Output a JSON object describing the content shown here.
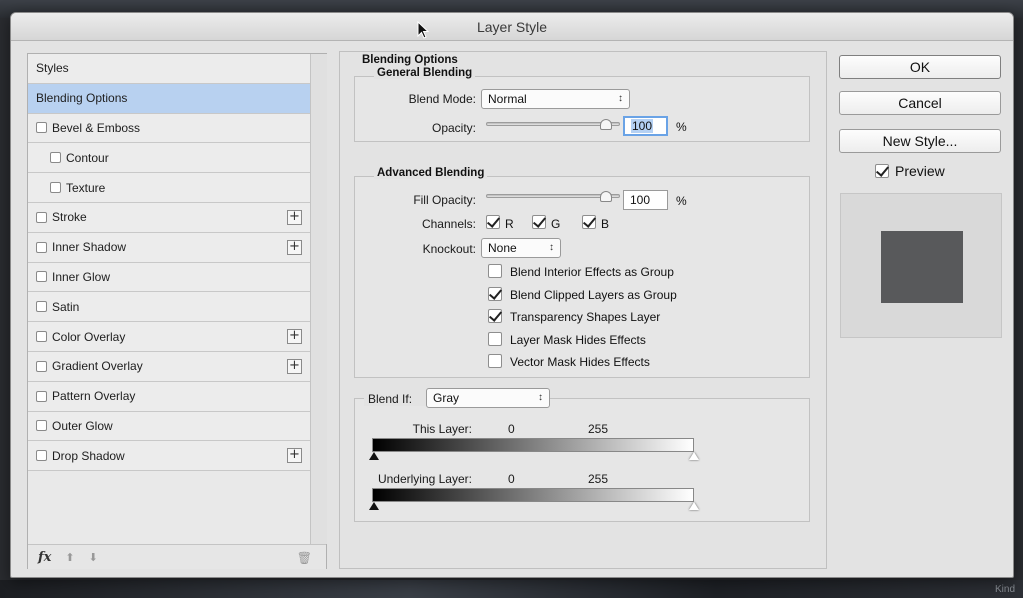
{
  "window": {
    "title": "Layer Style",
    "kind_label": "Kind"
  },
  "styles": {
    "header": "Styles",
    "items": [
      {
        "label": "Blending Options",
        "checkbox": false,
        "indent": false,
        "plus": false,
        "selected": true
      },
      {
        "label": "Bevel & Emboss",
        "checkbox": true,
        "indent": false,
        "plus": false
      },
      {
        "label": "Contour",
        "checkbox": true,
        "indent": true,
        "plus": false
      },
      {
        "label": "Texture",
        "checkbox": true,
        "indent": true,
        "plus": false
      },
      {
        "label": "Stroke",
        "checkbox": true,
        "indent": false,
        "plus": true
      },
      {
        "label": "Inner Shadow",
        "checkbox": true,
        "indent": false,
        "plus": true
      },
      {
        "label": "Inner Glow",
        "checkbox": true,
        "indent": false,
        "plus": false
      },
      {
        "label": "Satin",
        "checkbox": true,
        "indent": false,
        "plus": false
      },
      {
        "label": "Color Overlay",
        "checkbox": true,
        "indent": false,
        "plus": true
      },
      {
        "label": "Gradient Overlay",
        "checkbox": true,
        "indent": false,
        "plus": true
      },
      {
        "label": "Pattern Overlay",
        "checkbox": true,
        "indent": false,
        "plus": false
      },
      {
        "label": "Outer Glow",
        "checkbox": true,
        "indent": false,
        "plus": false
      },
      {
        "label": "Drop Shadow",
        "checkbox": true,
        "indent": false,
        "plus": true
      }
    ],
    "footer": {
      "fx_label": "fx",
      "plus_symbol": "+"
    }
  },
  "blending": {
    "title": "Blending Options",
    "general": {
      "title": "General Blending",
      "blend_mode_label": "Blend Mode:",
      "blend_mode_value": "Normal",
      "opacity_label": "Opacity:",
      "opacity_value": "100",
      "pct": "%"
    },
    "advanced": {
      "title": "Advanced Blending",
      "fill_opacity_label": "Fill Opacity:",
      "fill_opacity_value": "100",
      "pct": "%",
      "channels_label": "Channels:",
      "channels": [
        {
          "label": "R",
          "checked": true
        },
        {
          "label": "G",
          "checked": true
        },
        {
          "label": "B",
          "checked": true
        }
      ],
      "knockout_label": "Knockout:",
      "knockout_value": "None",
      "options": [
        {
          "label": "Blend Interior Effects as Group",
          "checked": false
        },
        {
          "label": "Blend Clipped Layers as Group",
          "checked": true
        },
        {
          "label": "Transparency Shapes Layer",
          "checked": true
        },
        {
          "label": "Layer Mask Hides Effects",
          "checked": false
        },
        {
          "label": "Vector Mask Hides Effects",
          "checked": false
        }
      ]
    },
    "blend_if": {
      "label": "Blend If:",
      "value": "Gray",
      "this_layer_label": "This Layer:",
      "this_layer_min": "0",
      "this_layer_max": "255",
      "underlying_label": "Underlying Layer:",
      "underlying_min": "0",
      "underlying_max": "255"
    }
  },
  "buttons": {
    "ok": "OK",
    "cancel": "Cancel",
    "new_style": "New Style...",
    "preview_label": "Preview",
    "preview_checked": true
  },
  "colors": {
    "selected_row": "#b8d1f0",
    "preview_swatch": "#58595b",
    "focus_ring": "#6aa3e6"
  }
}
